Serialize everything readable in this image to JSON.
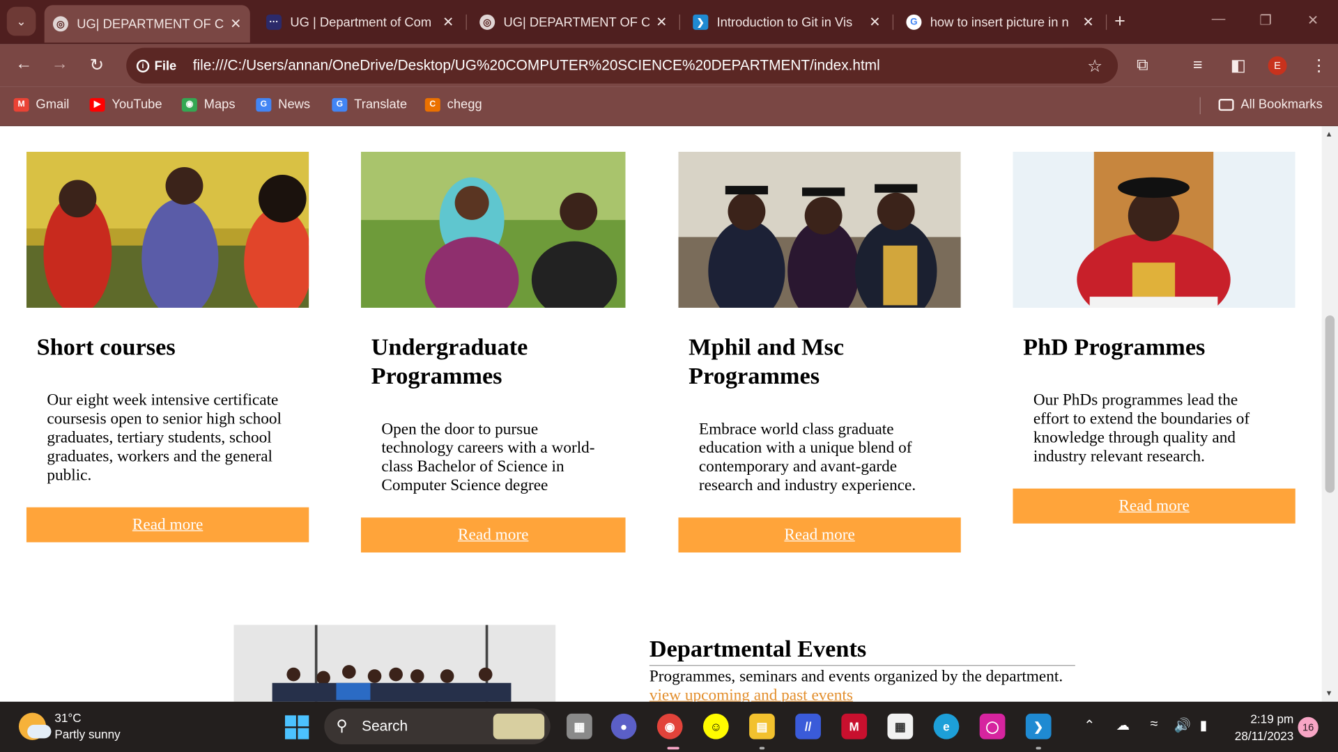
{
  "browser": {
    "tabs": [
      {
        "title": "UG| DEPARTMENT OF CO",
        "active": true
      },
      {
        "title": "UG | Department of Com",
        "active": false
      },
      {
        "title": "UG| DEPARTMENT OF CO",
        "active": false
      },
      {
        "title": "Introduction to Git in Vis",
        "active": false
      },
      {
        "title": "how to insert picture in n",
        "active": false
      }
    ],
    "omnibox": {
      "security_label": "File",
      "url": "file:///C:/Users/annan/OneDrive/Desktop/UG%20COMPUTER%20SCIENCE%20DEPARTMENT/index.html"
    },
    "profile_initial": "E",
    "bookmarks": [
      {
        "label": "Gmail",
        "icon": "gmail-icon",
        "color": "#ea4335"
      },
      {
        "label": "YouTube",
        "icon": "youtube-icon",
        "color": "#ff0000"
      },
      {
        "label": "Maps",
        "icon": "maps-icon",
        "color": "#34a853"
      },
      {
        "label": "News",
        "icon": "news-icon",
        "color": "#4285f4"
      },
      {
        "label": "Translate",
        "icon": "translate-icon",
        "color": "#4285f4"
      },
      {
        "label": "chegg",
        "icon": "chegg-icon",
        "color": "#eb7100"
      }
    ],
    "all_bookmarks": "All Bookmarks"
  },
  "page": {
    "cards": [
      {
        "title": "Short courses",
        "text": "Our eight week intensive certificate coursesis open to senior high school graduates, tertiary students, school graduates, workers and the general public.",
        "button": "Read more"
      },
      {
        "title": "Undergraduate Programmes",
        "text": "Open the door to pursue technology careers with a world-class Bachelor of Science in Computer Science degree",
        "button": "Read more"
      },
      {
        "title": "Mphil and Msc Programmes",
        "text": "Embrace world class graduate education with a unique blend of contemporary and avant-garde research and industry experience.",
        "button": "Read more"
      },
      {
        "title": "PhD Programmes",
        "text": "Our PhDs programmes lead the effort to extend the boundaries of knowledge through quality and industry relevant research.",
        "button": "Read more"
      }
    ],
    "events": {
      "title": "Departmental Events",
      "text": "Programmes, seminars and events organized by the department.",
      "link": "view upcoming and past events"
    },
    "accent_color": "#ffa43a"
  },
  "taskbar": {
    "weather_temp": "31°C",
    "weather_desc": "Partly sunny",
    "search_label": "Search",
    "time": "2:19 pm",
    "date": "28/11/2023",
    "notifications": "16"
  }
}
